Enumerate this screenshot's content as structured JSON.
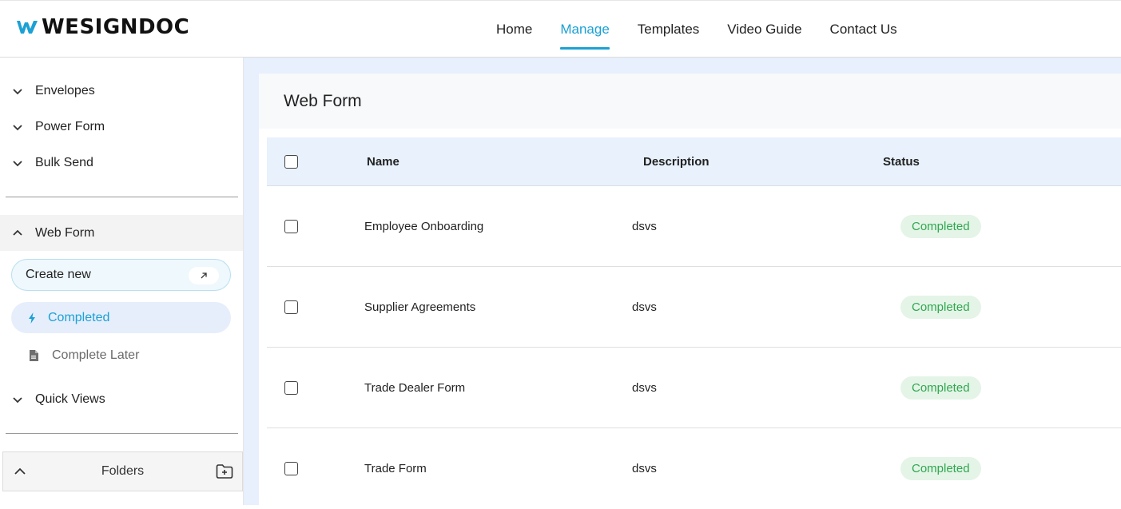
{
  "brand": {
    "logo_text": "WESIGNDOC",
    "logo_color": "#1ba1d4"
  },
  "nav": {
    "items": [
      {
        "label": "Home",
        "active": false
      },
      {
        "label": "Manage",
        "active": true
      },
      {
        "label": "Templates",
        "active": false
      },
      {
        "label": "Video Guide",
        "active": false
      },
      {
        "label": "Contact Us",
        "active": false
      }
    ]
  },
  "sidebar": {
    "sections": [
      {
        "label": "Envelopes",
        "icon": "chevron-down-icon"
      },
      {
        "label": "Power Form",
        "icon": "chevron-down-icon"
      },
      {
        "label": "Bulk Send",
        "icon": "chevron-down-icon"
      }
    ],
    "web_form": {
      "label": "Web Form",
      "icon": "chevron-up-icon",
      "create_new": "Create new",
      "create_new_icon": "arrow-up-right-icon",
      "items": [
        {
          "label": "Completed",
          "icon": "lightning-icon",
          "active": true
        },
        {
          "label": "Complete Later",
          "icon": "document-icon",
          "active": false
        }
      ]
    },
    "quick_views": {
      "label": "Quick Views",
      "icon": "chevron-down-icon"
    },
    "folders": {
      "label": "Folders",
      "toggle_icon": "chevron-up-icon",
      "add_icon": "add-folder-icon"
    }
  },
  "main": {
    "title": "Web Form",
    "table": {
      "columns": [
        "Name",
        "Description",
        "Status"
      ],
      "rows": [
        {
          "name": "Employee Onboarding",
          "description": "dsvs",
          "status": "Completed"
        },
        {
          "name": "Supplier Agreements",
          "description": "dsvs",
          "status": "Completed"
        },
        {
          "name": "Trade Dealer Form",
          "description": "dsvs",
          "status": "Completed"
        },
        {
          "name": "Trade Form",
          "description": "dsvs",
          "status": "Completed"
        }
      ]
    }
  },
  "colors": {
    "accent": "#1ba1d4",
    "status_green": "#2fa84f",
    "status_bg": "#e4f4e7",
    "main_bg": "#e7f0fc"
  }
}
